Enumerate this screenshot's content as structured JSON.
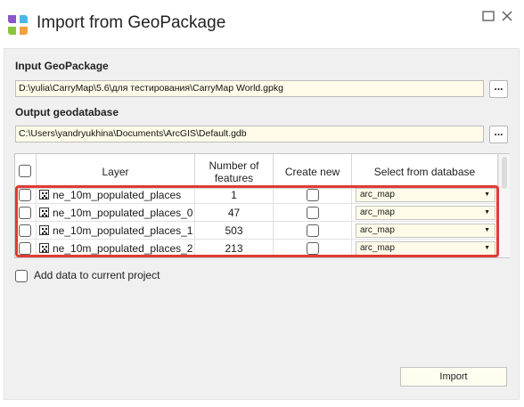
{
  "window": {
    "title": "Import from GeoPackage"
  },
  "input": {
    "label": "Input GeoPackage",
    "path": "D:\\yulia\\CarryMap\\5.6\\для тестирования\\CarryMap World.gpkg",
    "browse_label": "..."
  },
  "output": {
    "label": "Output geodatabase",
    "path": "C:\\Users\\yandryukhina\\Documents\\ArcGIS\\Default.gdb",
    "browse_label": "..."
  },
  "grid": {
    "columns": [
      "Layer",
      "Number of features",
      "Create new",
      "Select from database"
    ],
    "rows": [
      {
        "layer": "ne_10m_populated_places",
        "count": "1",
        "database": "arc_map"
      },
      {
        "layer": "ne_10m_populated_places_0",
        "count": "47",
        "database": "arc_map"
      },
      {
        "layer": "ne_10m_populated_places_1",
        "count": "503",
        "database": "arc_map"
      },
      {
        "layer": "ne_10m_populated_places_2",
        "count": "213",
        "database": "arc_map"
      }
    ]
  },
  "options": {
    "add_data_label": "Add data to current project"
  },
  "actions": {
    "import_label": "Import"
  },
  "icons": {
    "app": "geopackage-logo-icon",
    "layer": "point-layer-icon",
    "maximize": "maximize-icon",
    "close": "close-icon",
    "dropdown": "chevron-down-icon"
  },
  "colors": {
    "highlight": "#e03a35",
    "field_background": "#fffbe8"
  }
}
